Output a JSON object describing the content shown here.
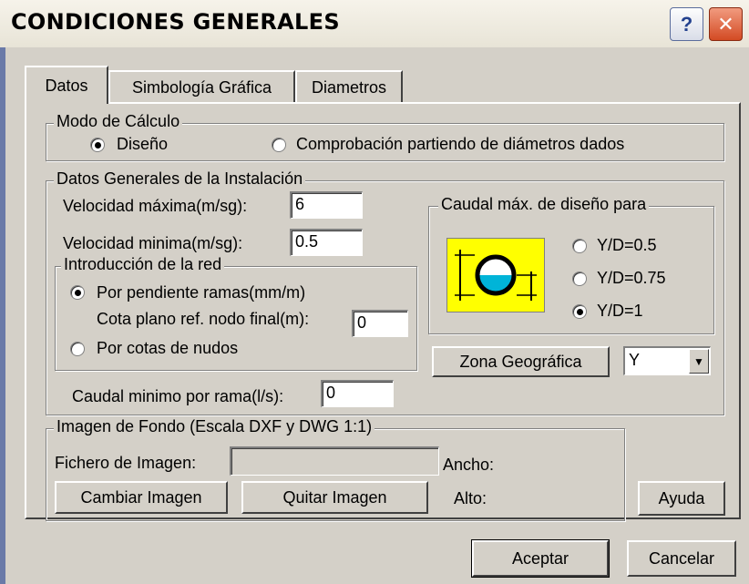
{
  "window": {
    "title": "CONDICIONES GENERALES",
    "help_label": "?",
    "close_label": "✕"
  },
  "tabs": [
    {
      "label": "Datos"
    },
    {
      "label": "Simbología Gráfica"
    },
    {
      "label": "Diametros"
    }
  ],
  "modo": {
    "legend": "Modo de Cálculo",
    "options": [
      {
        "label": "Diseño",
        "selected": true
      },
      {
        "label": "Comprobación partiendo de diámetros dados",
        "selected": false
      }
    ]
  },
  "datos": {
    "legend": "Datos Generales de la Instalación",
    "vel_max_label": "Velocidad máxima(m/sg):",
    "vel_max_value": "6",
    "vel_min_label": "Velocidad minima(m/sg):",
    "vel_min_value": "0.5",
    "caudal_min_label": "Caudal minimo por rama(l/s):",
    "caudal_min_value": "0"
  },
  "red": {
    "legend": "Introducción de la red",
    "opt1": "Por pendiente ramas(mm/m)",
    "cota_label": "Cota plano ref. nodo final(m):",
    "cota_value": "0",
    "opt2": "Por cotas de nudos"
  },
  "caudal": {
    "legend": "Caudal máx. de diseño para",
    "options": [
      {
        "label": "Y/D=0.5",
        "selected": false
      },
      {
        "label": "Y/D=0.75",
        "selected": false
      },
      {
        "label": "Y/D=1",
        "selected": true
      }
    ]
  },
  "zona": {
    "button": "Zona Geográfica",
    "value": "Y"
  },
  "imagen": {
    "legend": "Imagen de Fondo (Escala DXF y DWG 1:1)",
    "fichero_label": "Fichero de Imagen:",
    "fichero_value": "",
    "ancho_label": "Ancho:",
    "alto_label": "Alto:",
    "cambiar": "Cambiar Imagen",
    "quitar": "Quitar Imagen"
  },
  "buttons": {
    "ayuda": "Ayuda",
    "aceptar": "Aceptar",
    "cancelar": "Cancelar"
  },
  "colors": {
    "icon_bg": "#ffff00",
    "water": "#00b4d8",
    "pipe": "#000000"
  }
}
